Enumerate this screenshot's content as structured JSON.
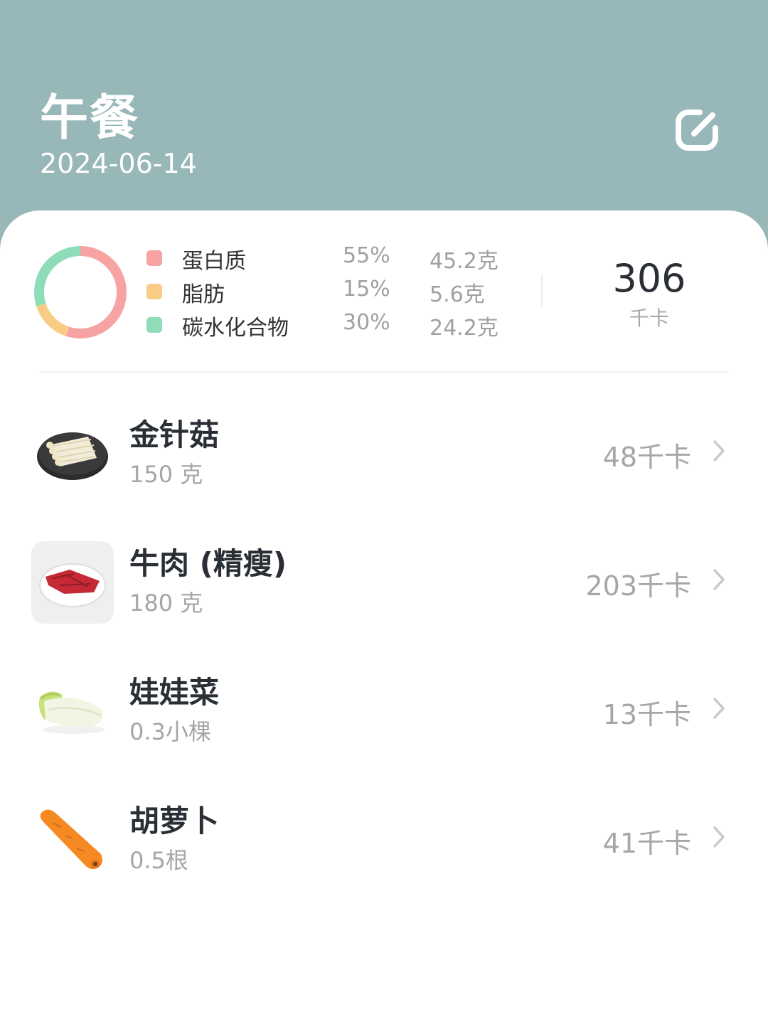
{
  "header": {
    "title": "午餐",
    "date": "2024-06-14",
    "edit_icon": "edit-icon",
    "background": "#98b7b8"
  },
  "nutrition": {
    "chart_data": {
      "type": "pie",
      "categories": [
        "蛋白质",
        "脂肪",
        "碳水化合物"
      ],
      "values": [
        55,
        15,
        30
      ],
      "colors": [
        "#f7a3a3",
        "#f9cc86",
        "#8fdcb9"
      ]
    },
    "macros": [
      {
        "name": "蛋白质",
        "percent": "55%",
        "amount": "45.2克",
        "color": "#f7a3a3"
      },
      {
        "name": "脂肪",
        "percent": "15%",
        "amount": "5.6克",
        "color": "#f9cc86"
      },
      {
        "name": "碳水化合物",
        "percent": "30%",
        "amount": "24.2克",
        "color": "#8fdcb9"
      }
    ],
    "total_value": "306",
    "total_unit": "千卡"
  },
  "foods": [
    {
      "name": "金针菇",
      "quantity": "150 克",
      "calories": "48千卡",
      "image": "enoki-mushroom-image"
    },
    {
      "name": "牛肉 (精瘦)",
      "quantity": "180 克",
      "calories": "203千卡",
      "image": "lean-beef-image"
    },
    {
      "name": "娃娃菜",
      "quantity": "0.3小棵",
      "calories": "13千卡",
      "image": "baby-cabbage-image"
    },
    {
      "name": "胡萝卜",
      "quantity": "0.5根",
      "calories": "41千卡",
      "image": "carrot-image"
    }
  ],
  "icons": {
    "chevron": "chevron-right-icon"
  }
}
